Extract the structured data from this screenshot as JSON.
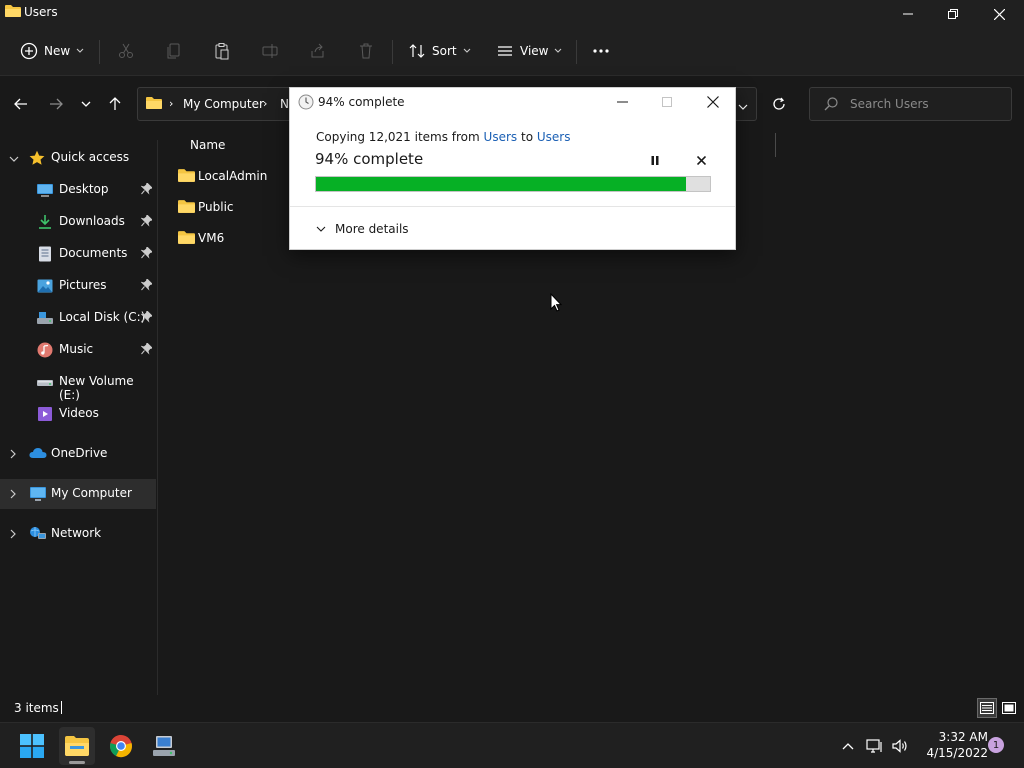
{
  "window": {
    "title": "Users"
  },
  "toolbar": {
    "new_label": "New",
    "sort_label": "Sort",
    "view_label": "View",
    "more_label": "..."
  },
  "address": {
    "path": [
      "My Computer",
      "N"
    ],
    "search_placeholder": "Search Users"
  },
  "sidebar": {
    "quick_access": "Quick access",
    "items": [
      {
        "label": "Desktop",
        "icon": "desktop-icon",
        "pinned": true
      },
      {
        "label": "Downloads",
        "icon": "download-icon",
        "pinned": true
      },
      {
        "label": "Documents",
        "icon": "document-icon",
        "pinned": true
      },
      {
        "label": "Pictures",
        "icon": "picture-icon",
        "pinned": true
      },
      {
        "label": "Local Disk (C:)",
        "icon": "drive-icon",
        "pinned": true
      },
      {
        "label": "Music",
        "icon": "music-icon",
        "pinned": true
      },
      {
        "label": "New Volume (E:)",
        "icon": "drive-icon",
        "pinned": false
      },
      {
        "label": "Videos",
        "icon": "video-icon",
        "pinned": false
      }
    ],
    "onedrive": "OneDrive",
    "my_computer": "My Computer",
    "network": "Network"
  },
  "files": {
    "column_name": "Name",
    "items": [
      "LocalAdmin",
      "Public",
      "VM6"
    ]
  },
  "status": {
    "item_count": "3 items"
  },
  "copy_dialog": {
    "title": "94% complete",
    "copying_prefix": "Copying 12,021 items from",
    "source": "Users",
    "to_word": "to",
    "destination": "Users",
    "percent_text": "94% complete",
    "progress": 0.94,
    "progress_color": "#06b025",
    "more_details": "More details"
  },
  "taskbar": {
    "apps": [
      "start-icon",
      "file-explorer-icon",
      "chrome-icon",
      "network-setup-icon"
    ],
    "time": "3:32 AM",
    "date": "4/15/2022",
    "notification_count": "1"
  }
}
